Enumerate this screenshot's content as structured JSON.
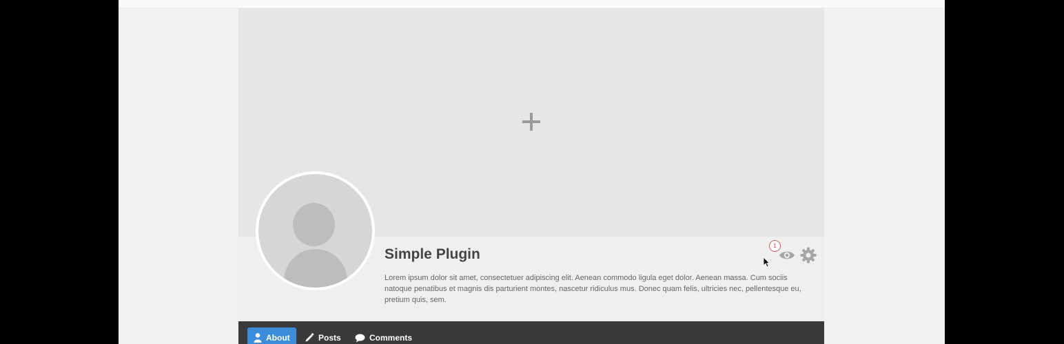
{
  "profile": {
    "name": "Simple Plugin",
    "bio": "Lorem ipsum dolor sit amet, consectetuer adipiscing elit. Aenean commodo ligula eget dolor. Aenean massa. Cum sociis natoque penatibus et magnis dis parturient montes, nascetur ridiculus mus. Donec quam felis, ultricies nec, pellentesque eu, pretium quis, sem."
  },
  "meta": {
    "badge_count": "1",
    "icons": [
      "eye-icon",
      "gear-icon"
    ]
  },
  "tabs": [
    {
      "label": "About",
      "icon": "user-icon",
      "active": true
    },
    {
      "label": "Posts",
      "icon": "pencil-icon",
      "active": false
    },
    {
      "label": "Comments",
      "icon": "comment-icon",
      "active": false
    }
  ],
  "colors": {
    "accent": "#3c8dd9",
    "tabbar": "#3a3a3a",
    "cover": "#e6e6e6",
    "badge": "#d33333"
  }
}
